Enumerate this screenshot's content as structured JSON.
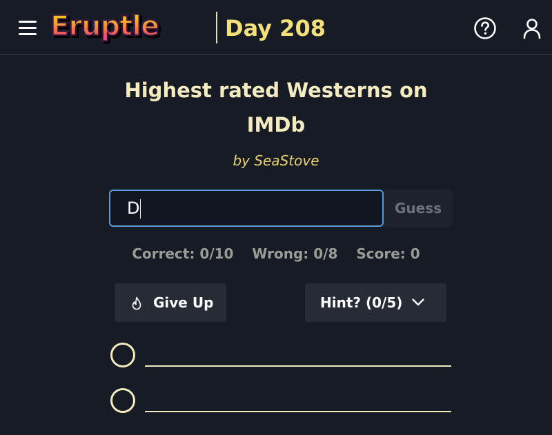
{
  "header": {
    "logo_text": "Eruptle",
    "day_label": "Day 208"
  },
  "quiz": {
    "title": "Highest rated Westerns on IMDb",
    "byline": "by SeaStove"
  },
  "guess": {
    "input_value": "D",
    "button_label": "Guess"
  },
  "stats": {
    "correct": "Correct: 0/10",
    "wrong": "Wrong: 0/8",
    "score": "Score: 0"
  },
  "actions": {
    "give_up_label": "Give Up",
    "hint_label": "Hint? (0/5)"
  },
  "answers": [
    {
      "text": ""
    },
    {
      "text": ""
    }
  ],
  "colors": {
    "background": "#171b26",
    "accent_yellow": "#f3e07a",
    "title_cream": "#f5ebc0",
    "input_border": "#5b9bd9",
    "button_bg": "#272b36"
  },
  "icons": [
    "menu-icon",
    "help-icon",
    "user-icon",
    "fire-icon",
    "chevron-down-icon"
  ]
}
